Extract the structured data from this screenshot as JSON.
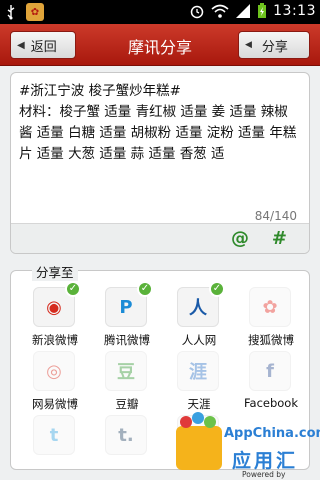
{
  "status_bar": {
    "time": "13:13",
    "icons": [
      "usb-icon",
      "app-notification-icon",
      "alarm-icon",
      "wifi-icon",
      "signal-icon",
      "battery-charging-icon"
    ]
  },
  "header": {
    "back_label": "返回",
    "title": "摩讯分享",
    "share_label": "分享"
  },
  "editor": {
    "text": "#浙江宁波 梭子蟹炒年糕#\n材料：梭子蟹 适量 青红椒 适量 姜 适量 辣椒酱 适量 白糖 适量 胡椒粉 适量 淀粉 适量 年糕片 适量 大葱 适量 蒜 适量 香葱 适",
    "counter": "84/140",
    "at_symbol": "@",
    "hash_symbol": "#"
  },
  "share_panel": {
    "title": "分享至",
    "targets": [
      {
        "label": "新浪微博",
        "icon": "sina-weibo-icon",
        "checked": true,
        "glyph": "◉",
        "color": "#d52b1e"
      },
      {
        "label": "腾讯微博",
        "icon": "tencent-weibo-icon",
        "checked": true,
        "glyph": "P",
        "color": "#1b8bd6"
      },
      {
        "label": "人人网",
        "icon": "renren-icon",
        "checked": true,
        "glyph": "人",
        "color": "#1a5aa8"
      },
      {
        "label": "搜狐微博",
        "icon": "sohu-weibo-icon",
        "checked": false,
        "glyph": "✿",
        "color": "#e3352d"
      },
      {
        "label": "网易微博",
        "icon": "netease-weibo-icon",
        "checked": false,
        "glyph": "◎",
        "color": "#d52b1e"
      },
      {
        "label": "豆瓣",
        "icon": "douban-icon",
        "checked": false,
        "glyph": "豆",
        "color": "#3a9a3a"
      },
      {
        "label": "天涯",
        "icon": "tianya-icon",
        "checked": false,
        "glyph": "涯",
        "color": "#3a7ac8"
      },
      {
        "label": "Facebook",
        "icon": "facebook-icon",
        "checked": false,
        "glyph": "f",
        "color": "#3b5998"
      },
      {
        "label": "",
        "icon": "twitter-icon",
        "checked": false,
        "glyph": "t",
        "color": "#3ba5e0"
      },
      {
        "label": "",
        "icon": "tumblr-icon",
        "checked": false,
        "glyph": "t.",
        "color": "#34526f"
      },
      {
        "label": "",
        "icon": "more-app-icon",
        "checked": false,
        "glyph": "",
        "color": "#cccccc"
      }
    ]
  },
  "watermark": {
    "title": "AppChina.com",
    "subtitle": "应用汇",
    "powered_by": "Powered by MobCent"
  }
}
